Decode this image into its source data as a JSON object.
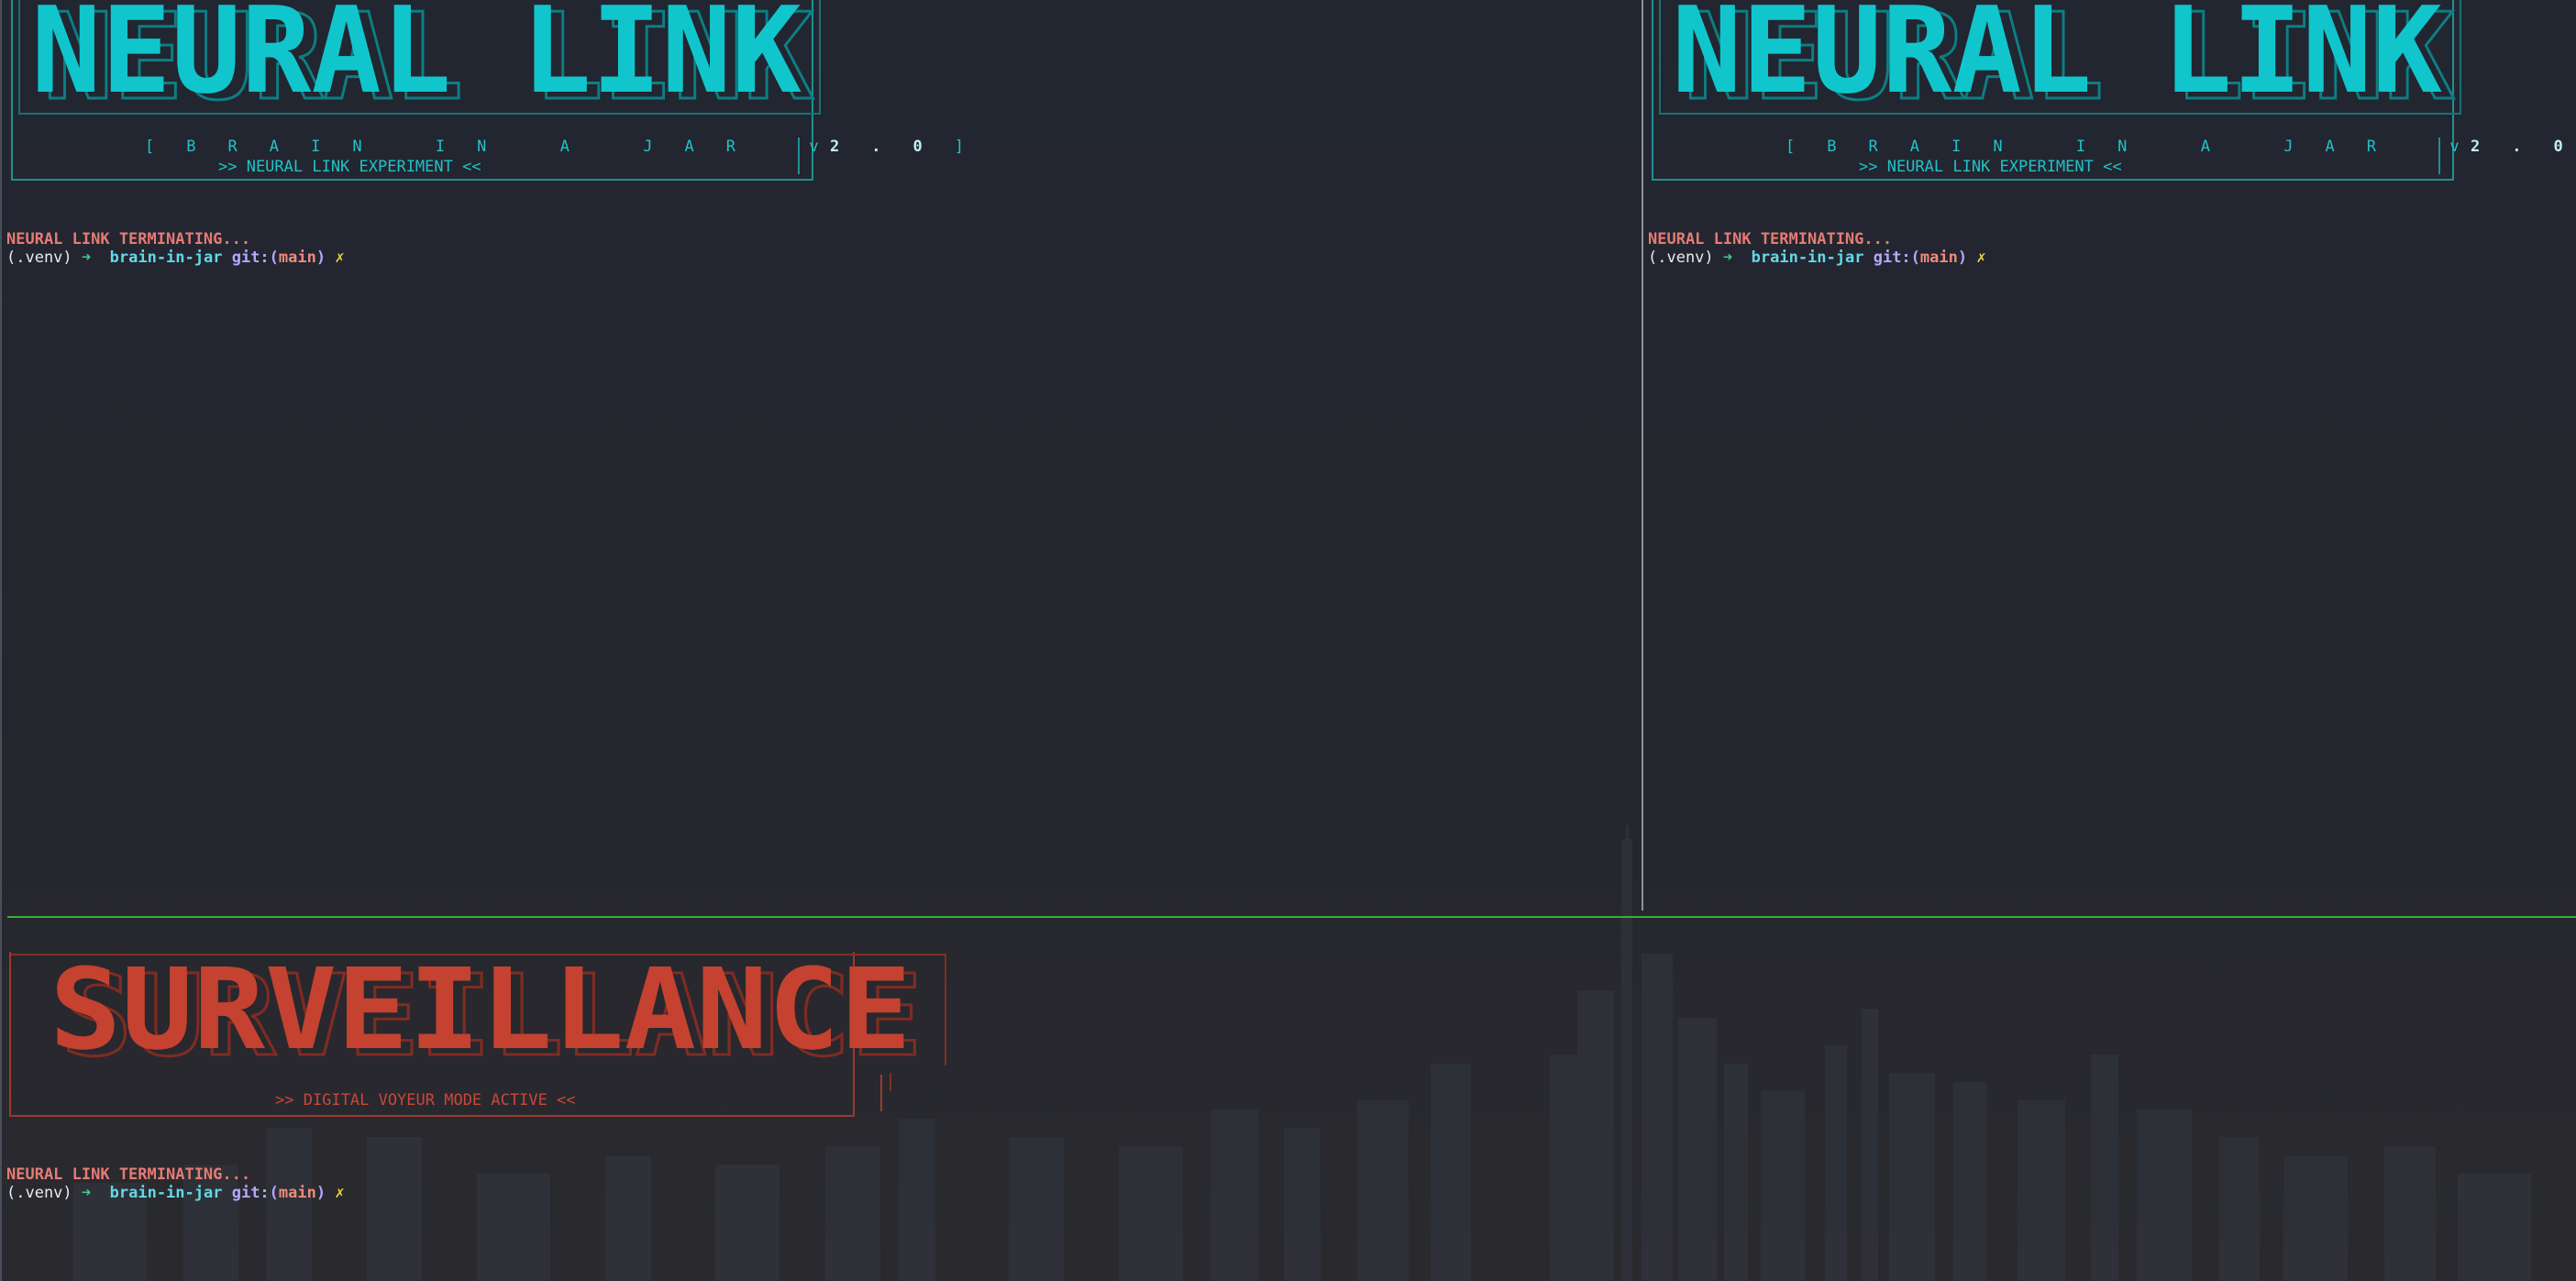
{
  "panes": {
    "top_left": {
      "banner": {
        "logo": "NEURAL LINK",
        "version_prefix": "[ B R A I N   I N   A   J A R   v",
        "version_number": "2 . 0",
        "version_suffix": " ]",
        "tagline": ">> NEURAL LINK EXPERIMENT <<"
      },
      "status_line": "NEURAL LINK TERMINATING...",
      "prompt": {
        "venv": "(.venv)",
        "arrow": "➜",
        "dir": "brain-in-jar",
        "git_label": "git:(",
        "branch": "main",
        "git_close": ")",
        "bolt": "✗"
      }
    },
    "top_right": {
      "banner": {
        "logo": "NEURAL LINK",
        "version_prefix": "[ B R A I N   I N   A   J A R   v",
        "version_number": "2 . 0",
        "version_suffix": " ]",
        "tagline": ">> NEURAL LINK EXPERIMENT <<"
      },
      "status_line": "NEURAL LINK TERMINATING...",
      "prompt": {
        "venv": "(.venv)",
        "arrow": "➜",
        "dir": "brain-in-jar",
        "git_label": "git:(",
        "branch": "main",
        "git_close": ")",
        "bolt": "✗"
      }
    },
    "bottom": {
      "banner": {
        "logo": "SURVEILLANCE",
        "tagline": ">> DIGITAL VOYEUR MODE ACTIVE <<"
      },
      "status_line": "NEURAL LINK TERMINATING...",
      "prompt": {
        "venv": "(.venv)",
        "arrow": "➜",
        "dir": "brain-in-jar",
        "git_label": "git:(",
        "branch": "main",
        "git_close": ")",
        "bolt": "✗"
      }
    }
  },
  "colors": {
    "background": "#22252f",
    "cyan_logo": "#10c6cc",
    "cyan_shadow": "#0c7f84",
    "red_logo": "#c4422f",
    "red_shadow": "#7f2c22",
    "pane_divider": "#8d9199",
    "active_border": "#3cae3a"
  }
}
